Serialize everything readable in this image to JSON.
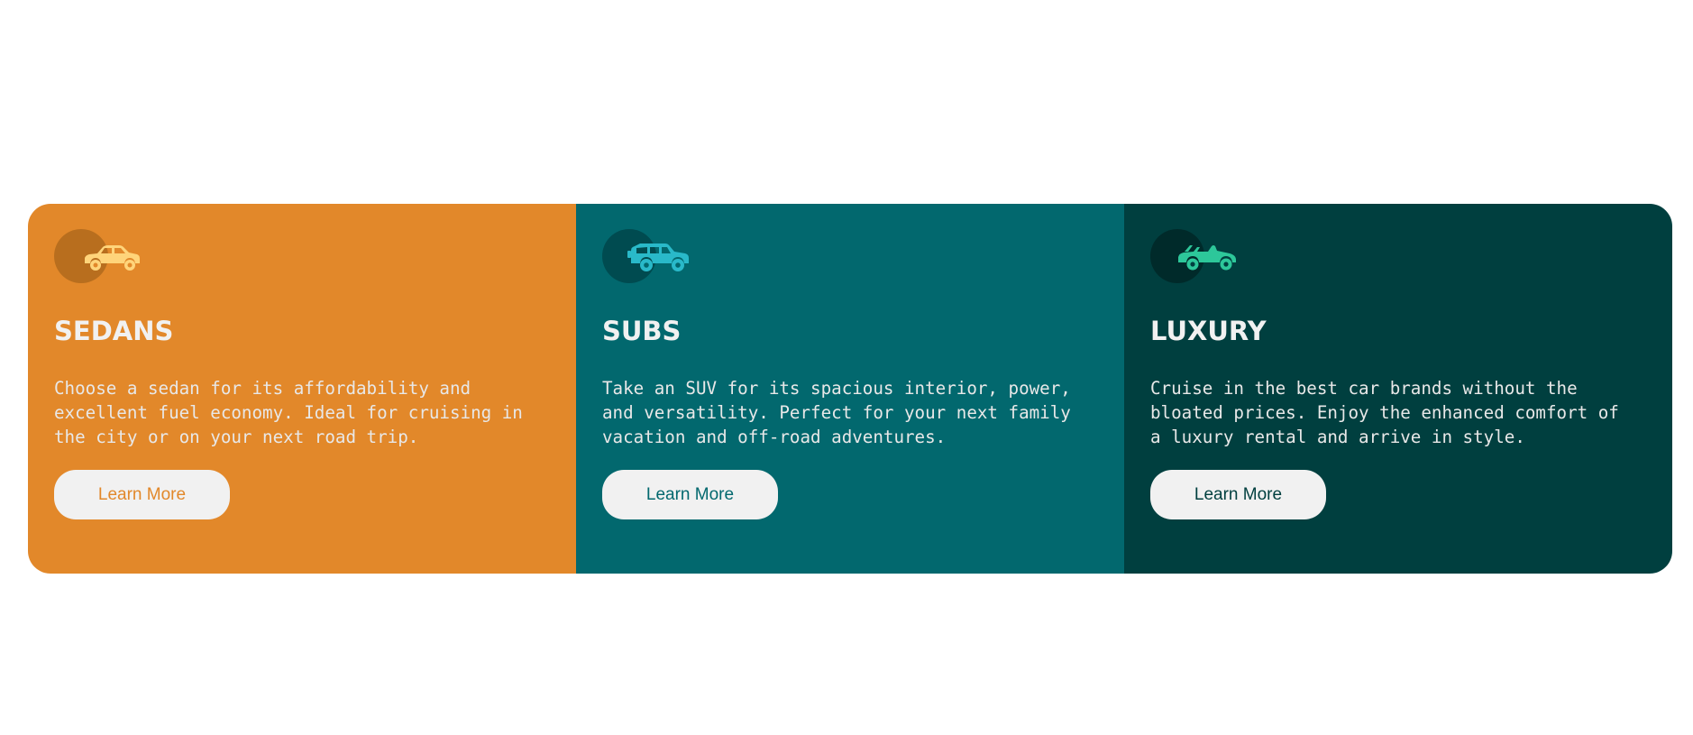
{
  "cards": [
    {
      "title": "SEDANS",
      "text": "Choose a sedan for its affordability and excellent fuel economy. Ideal for cruising in the city or on your next road trip.",
      "button_label": "Learn More",
      "icon": "sedan-car-icon",
      "bg_color": "#e2882a",
      "circle_color": "#b86e1e",
      "icon_color": "#ffd47a",
      "button_text_color": "#e2882a"
    },
    {
      "title": "SUBS",
      "text": "Take an SUV for its spacious interior, power, and versatility. Perfect for your next family vacation and off-road adventures.",
      "button_label": "Learn More",
      "icon": "suv-car-icon",
      "bg_color": "#02686e",
      "circle_color": "#004b50",
      "icon_color": "#29b9c9",
      "button_text_color": "#02686e"
    },
    {
      "title": "LUXURY",
      "text": "Cruise in the best car brands without the bloated prices. Enjoy the enhanced comfort of a luxury rental and arrive in style.",
      "button_label": "Learn More",
      "icon": "convertible-car-icon",
      "bg_color": "#003f3f",
      "circle_color": "#002a2a",
      "icon_color": "#2dc79a",
      "button_text_color": "#003f3f"
    }
  ]
}
